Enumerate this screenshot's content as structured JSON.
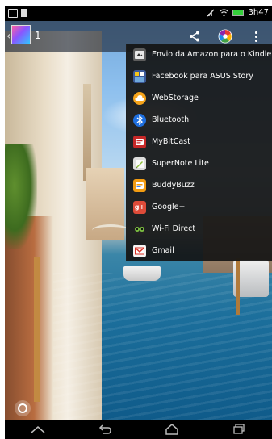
{
  "status_bar": {
    "time": "3h47",
    "battery_color": "#35d03b"
  },
  "action_bar": {
    "count": "1",
    "icons": [
      "back-chevron-icon",
      "app-thumbnail",
      "share-icon",
      "picasa-icon",
      "overflow-menu-icon"
    ]
  },
  "share_menu": {
    "items": [
      {
        "label": "Envio da Amazon para o Kindle",
        "icon": "kindle-icon",
        "color": "#6b6b6b"
      },
      {
        "label": "Facebook para ASUS Story",
        "icon": "asus-story-icon",
        "color": "#3b5998"
      },
      {
        "label": "WebStorage",
        "icon": "webstorage-icon",
        "color": "#f5a31a"
      },
      {
        "label": "Bluetooth",
        "icon": "bluetooth-icon",
        "color": "#1e6fe0"
      },
      {
        "label": "MyBitCast",
        "icon": "mybitcast-icon",
        "color": "#d12b2b"
      },
      {
        "label": "SuperNote Lite",
        "icon": "supernote-icon",
        "color": "#8dbf3a"
      },
      {
        "label": "BuddyBuzz",
        "icon": "buddybuzz-icon",
        "color": "#f39c12"
      },
      {
        "label": "Google+",
        "icon": "google-plus-icon",
        "color": "#dd4b39"
      },
      {
        "label": "Wi-Fi Direct",
        "icon": "wifi-direct-icon",
        "color": "#222222"
      },
      {
        "label": "Gmail",
        "icon": "gmail-icon",
        "color": "#d93025"
      }
    ]
  },
  "nav_bar": {
    "buttons": [
      "home-up-icon",
      "back-icon",
      "home-icon",
      "recent-apps-icon"
    ]
  }
}
